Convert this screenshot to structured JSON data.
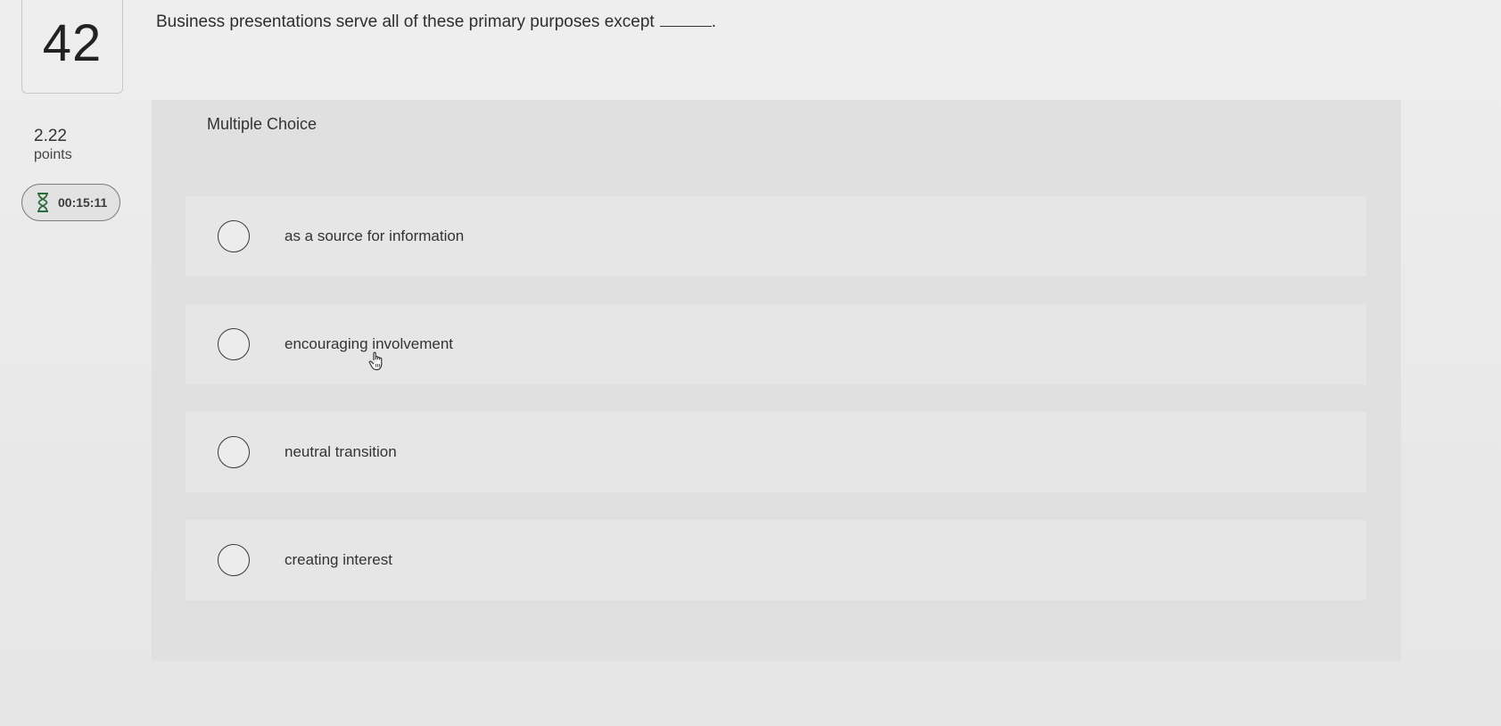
{
  "question": {
    "number": "42",
    "points_value": "2.22",
    "points_label": "points",
    "timer": "00:15:11",
    "text": "Business presentations serve all of these primary purposes except",
    "trailing": "."
  },
  "multiple_choice": {
    "title": "Multiple Choice",
    "options": [
      {
        "label": "as a source for information"
      },
      {
        "label": "encouraging involvement"
      },
      {
        "label": "neutral transition"
      },
      {
        "label": "creating interest"
      }
    ]
  },
  "icons": {
    "timer": "hourglass-icon",
    "cursor": "hand-pointer-icon"
  }
}
